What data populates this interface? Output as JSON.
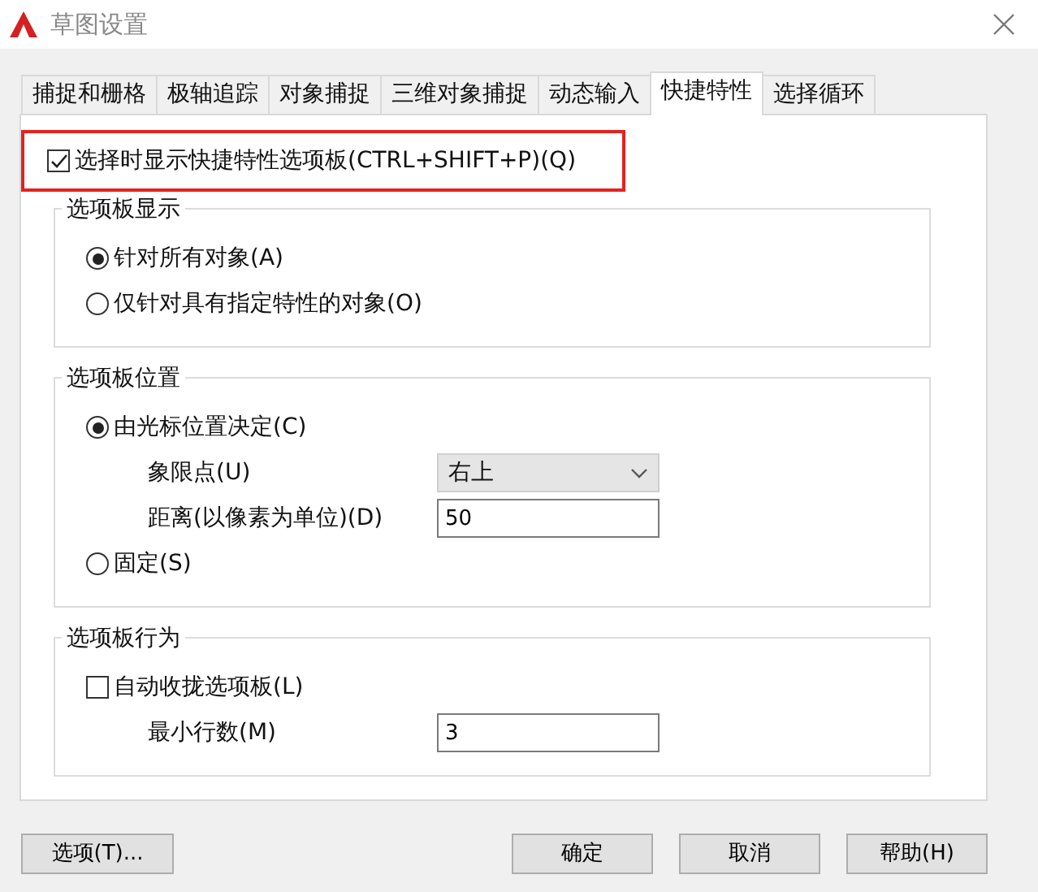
{
  "window": {
    "title": "草图设置"
  },
  "tabs": [
    {
      "label": "捕捉和栅格",
      "selected": false
    },
    {
      "label": "极轴追踪",
      "selected": false
    },
    {
      "label": "对象捕捉",
      "selected": false
    },
    {
      "label": "三维对象捕捉",
      "selected": false
    },
    {
      "label": "动态输入",
      "selected": false
    },
    {
      "label": "快捷特性",
      "selected": true
    },
    {
      "label": "选择循环",
      "selected": false
    }
  ],
  "main_checkbox": {
    "label": "选择时显示快捷特性选项板(CTRL+SHIFT+P)(Q)",
    "checked": true,
    "highlighted": true
  },
  "groups": [
    {
      "title": "选项板显示",
      "items": [
        {
          "kind": "radio",
          "label": "针对所有对象(A)",
          "selected": true
        },
        {
          "kind": "radio",
          "label": "仅针对具有指定特性的对象(O)",
          "selected": false
        }
      ]
    },
    {
      "title": "选项板位置",
      "items": [
        {
          "kind": "radio",
          "label": "由光标位置决定(C)",
          "selected": true
        },
        {
          "kind": "dropdown",
          "label": "象限点(U)",
          "value": "右上"
        },
        {
          "kind": "textfield",
          "label": "距离(以像素为单位)(D)",
          "value": "50"
        },
        {
          "kind": "radio",
          "label": "固定(S)",
          "selected": false
        }
      ]
    },
    {
      "title": "选项板行为",
      "items": [
        {
          "kind": "checkbox",
          "label": "自动收拢选项板(L)",
          "checked": false
        },
        {
          "kind": "textfield",
          "label": "最小行数(M)",
          "value": "3"
        }
      ]
    }
  ],
  "buttons": [
    "选项(T)...",
    "确定",
    "取消",
    "帮助(H)"
  ]
}
